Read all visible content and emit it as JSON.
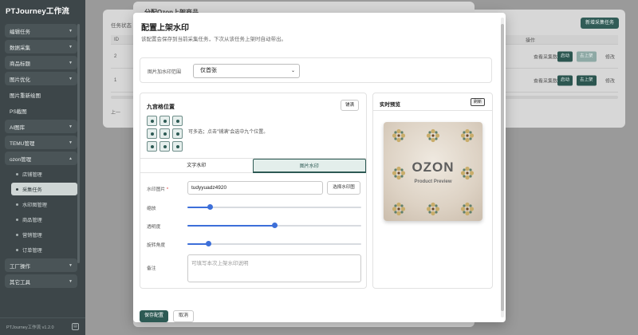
{
  "sidebar": {
    "brand": "PTJourney工作流",
    "items": [
      {
        "label": "编辑任务",
        "chevron": true
      },
      {
        "label": "数据采集",
        "chevron": true
      },
      {
        "label": "商品标题",
        "chevron": true
      },
      {
        "label": "图片优化",
        "chevron": true
      },
      {
        "label": "图片重新绘图",
        "chevron": false
      },
      {
        "label": "PS截图",
        "chevron": false
      },
      {
        "label": "AI图库",
        "chevron": true
      },
      {
        "label": "TEMU管理",
        "chevron": true
      },
      {
        "label": "ozon管理",
        "chevron": true
      }
    ],
    "sub_items": [
      {
        "label": "店铺管理",
        "active": false
      },
      {
        "label": "采集任务",
        "active": true
      },
      {
        "label": "水印图管理",
        "active": false
      },
      {
        "label": "商品管理",
        "active": false
      },
      {
        "label": "营销管理",
        "active": false
      },
      {
        "label": "订单管理",
        "active": false
      }
    ],
    "bottom_items": [
      {
        "label": "工厂操作",
        "chevron": true
      },
      {
        "label": "其它工具",
        "chevron": true
      }
    ],
    "footer": "PTJourney工作流 v1.2.0"
  },
  "background": {
    "task_status_label": "任务状态",
    "new_task_button": "新增采集任务",
    "col_id": "ID",
    "col_ops": "操作",
    "rows": [
      {
        "id": "2",
        "view": "查看采集数据",
        "start": "启动",
        "launch": "去上架",
        "edit": "修改"
      },
      {
        "id": "1",
        "view": "查看采集数据",
        "start": "启动",
        "launch": "去上架",
        "edit": "修改"
      }
    ],
    "pager_prefix": "上一",
    "dialog_title": "分配Ozon上架商品"
  },
  "modal": {
    "title": "配置上架水印",
    "desc": "该配置会保存到当前采集任务，下次从该任务上架时自动带出。",
    "scope": {
      "label": "图片加水印范围",
      "value": "仅首张"
    },
    "grid": {
      "title": "九宫格位置",
      "tile_button": "铺满",
      "hint": "可多选；点击\"铺满\"会选中九个位置。",
      "cells": [
        "top-left",
        "top-center",
        "top-right",
        "middle-left",
        "middle-center",
        "middle-right",
        "bottom-left",
        "bottom-center",
        "bottom-right"
      ]
    },
    "tabs": [
      {
        "label": "文字水印",
        "active": false
      },
      {
        "label": "图片水印",
        "active": true
      }
    ],
    "fields": {
      "image_label": "水印图片",
      "required_mark": "*",
      "image_value": "tudyyuadz4920",
      "choose_button": "选择水印图",
      "scale_label": "缩放",
      "scale_value": 0.13,
      "opacity_label": "透明度",
      "opacity_value": 0.5,
      "rotate_label": "旋转角度",
      "rotate_value": 0.12,
      "note_label": "备注",
      "note_placeholder": "可填写本次上架水印说明"
    },
    "preview": {
      "title": "实时预览",
      "refresh_button": "刷新",
      "image_title": "OZON",
      "image_subtitle": "Product Preview"
    },
    "save_button": "保存配置",
    "cancel_button": "取消"
  },
  "colors": {
    "accent": "#2d5a54",
    "slider": "#3d6fd9",
    "sidebar_bg": "#3d4649"
  }
}
